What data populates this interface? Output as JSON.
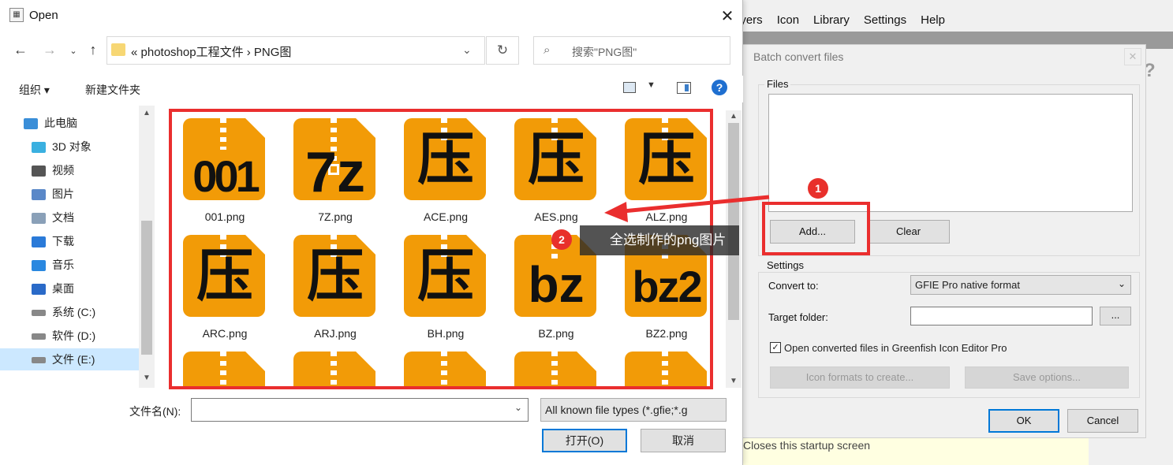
{
  "background_app": {
    "menu": [
      "ayers",
      "Icon",
      "Library",
      "Settings",
      "Help"
    ],
    "footer_text": "Closes this startup screen"
  },
  "batch_dialog": {
    "title": "Batch convert files",
    "files_group": "Files",
    "add_label": "Add...",
    "clear_label": "Clear",
    "settings_group": "Settings",
    "convert_to_label": "Convert to:",
    "convert_to_value": "GFIE Pro native format",
    "target_folder_label": "Target folder:",
    "browse_label": "...",
    "open_converted_label": "Open converted files in Greenfish Icon Editor Pro",
    "open_converted_checked": true,
    "icon_formats_label": "Icon formats to create...",
    "save_options_label": "Save options...",
    "ok_label": "OK",
    "cancel_label": "Cancel"
  },
  "open_dialog": {
    "title": "Open",
    "breadcrumb": "«   photoshop工程文件   ›   PNG图",
    "search_placeholder": "搜索\"PNG图\"",
    "organize_label": "组织 ▾",
    "new_folder_label": "新建文件夹",
    "nav_items": [
      {
        "label": "此电脑",
        "icon": "computer-icon",
        "color": "#3a8ed8"
      },
      {
        "label": "3D 对象",
        "icon": "cube-icon",
        "color": "#3ab0e0"
      },
      {
        "label": "视频",
        "icon": "film-icon",
        "color": "#555555"
      },
      {
        "label": "图片",
        "icon": "pictures-icon",
        "color": "#5a88c8"
      },
      {
        "label": "文档",
        "icon": "document-icon",
        "color": "#8aa0b8"
      },
      {
        "label": "下载",
        "icon": "download-icon",
        "color": "#2a7ad8"
      },
      {
        "label": "音乐",
        "icon": "music-icon",
        "color": "#2a88e0"
      },
      {
        "label": "桌面",
        "icon": "desktop-icon",
        "color": "#2a6ac8"
      },
      {
        "label": "系统 (C:)",
        "icon": "drive-icon",
        "color": "#888888"
      },
      {
        "label": "软件 (D:)",
        "icon": "drive-icon",
        "color": "#888888"
      },
      {
        "label": "文件 (E:)",
        "icon": "drive-icon",
        "color": "#888888"
      }
    ],
    "files": [
      {
        "name": "001.png",
        "glyph": "001"
      },
      {
        "name": "7Z.png",
        "glyph": "7z"
      },
      {
        "name": "ACE.png",
        "glyph": "压"
      },
      {
        "name": "AES.png",
        "glyph": "压"
      },
      {
        "name": "ALZ.png",
        "glyph": "压"
      },
      {
        "name": "ARC.png",
        "glyph": "压"
      },
      {
        "name": "ARJ.png",
        "glyph": "压"
      },
      {
        "name": "BH.png",
        "glyph": "压"
      },
      {
        "name": "BZ.png",
        "glyph": "bz"
      },
      {
        "name": "BZ2.png",
        "glyph": "bz2"
      }
    ],
    "filename_label": "文件名(N):",
    "filename_value": "",
    "filetype_value": "All known file types (*.gfie;*.g",
    "open_label": "打开(O)",
    "cancel_label": "取消"
  },
  "annotations": {
    "step1": "1",
    "step2": "2",
    "tooltip": "全选制作的png图片",
    "color": "#ea2e2e"
  }
}
